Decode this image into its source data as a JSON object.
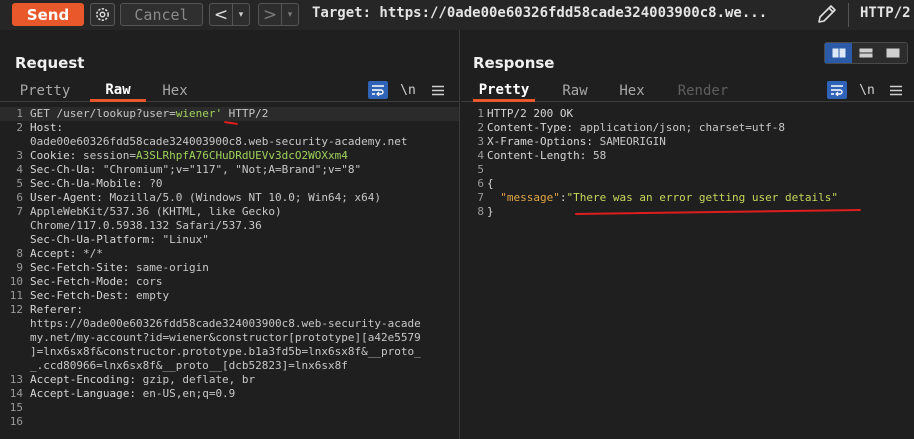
{
  "toolbar": {
    "send_label": "Send",
    "cancel_label": "Cancel",
    "back_glyph": "<",
    "forward_glyph": ">",
    "dropdown_glyph": "▾",
    "target_text": "Target: https://0ade00e60326fdd58cade324003900c8.we...",
    "protocol": "HTTP/2"
  },
  "request": {
    "title": "Request",
    "tabs": [
      {
        "label": "Pretty",
        "active": false
      },
      {
        "label": "Raw",
        "active": true
      },
      {
        "label": "Hex",
        "active": false
      }
    ],
    "newline_toggle": "\\n",
    "gutter": [
      "1",
      "2",
      "",
      "3",
      "4",
      "5",
      "6",
      "7",
      "",
      "",
      "8",
      "9",
      "10",
      "11",
      "12",
      "",
      "",
      "",
      "",
      "13",
      "14",
      "15",
      "16"
    ],
    "lines": [
      {
        "k": "",
        "v": "GET /user/lookup?user=",
        "g": "wiener'",
        "t": " HTTP/2"
      },
      {
        "k": "Host:",
        "v": "",
        "g": "",
        "t": ""
      },
      {
        "k": "",
        "v": "0ade00e60326fdd58cade324003900c8.web-security-academy.net",
        "g": "",
        "t": ""
      },
      {
        "k": "Cookie:",
        "v": " session=",
        "g": "A3SLRhpfA76CHuDRdUEVv3dcO2WOXxm4",
        "t": ""
      },
      {
        "k": "Sec-Ch-Ua:",
        "v": " \"Chromium\";v=\"117\", \"Not;A=Brand\";v=\"8\"",
        "g": "",
        "t": ""
      },
      {
        "k": "Sec-Ch-Ua-Mobile:",
        "v": " ?0",
        "g": "",
        "t": ""
      },
      {
        "k": "User-Agent:",
        "v": " Mozilla/5.0 (Windows NT 10.0; Win64; x64)",
        "g": "",
        "t": ""
      },
      {
        "k": "",
        "v": "AppleWebKit/537.36 (KHTML, like Gecko)",
        "g": "",
        "t": ""
      },
      {
        "k": "",
        "v": "Chrome/117.0.5938.132 Safari/537.36",
        "g": "",
        "t": ""
      },
      {
        "k": "Sec-Ch-Ua-Platform:",
        "v": " \"Linux\"",
        "g": "",
        "t": ""
      },
      {
        "k": "Accept:",
        "v": " */*",
        "g": "",
        "t": ""
      },
      {
        "k": "Sec-Fetch-Site:",
        "v": " same-origin",
        "g": "",
        "t": ""
      },
      {
        "k": "Sec-Fetch-Mode:",
        "v": " cors",
        "g": "",
        "t": ""
      },
      {
        "k": "Sec-Fetch-Dest:",
        "v": " empty",
        "g": "",
        "t": ""
      },
      {
        "k": "Referer:",
        "v": "",
        "g": "",
        "t": ""
      },
      {
        "k": "",
        "v": "https://0ade00e60326fdd58cade324003900c8.web-security-acade",
        "g": "",
        "t": ""
      },
      {
        "k": "",
        "v": "my.net/my-account?id=wiener&constructor[prototype][a42e5579",
        "g": "",
        "t": ""
      },
      {
        "k": "",
        "v": "]=lnx6sx8f&constructor.prototype.b1a3fd5b=lnx6sx8f&__proto_",
        "g": "",
        "t": ""
      },
      {
        "k": "",
        "v": "_.ccd80966=lnx6sx8f&__proto__[dcb52823]=lnx6sx8f",
        "g": "",
        "t": ""
      },
      {
        "k": "Accept-Encoding:",
        "v": " gzip, deflate, br",
        "g": "",
        "t": ""
      },
      {
        "k": "Accept-Language:",
        "v": " en-US,en;q=0.9",
        "g": "",
        "t": ""
      },
      {
        "k": "",
        "v": "",
        "g": "",
        "t": ""
      },
      {
        "k": "",
        "v": "",
        "g": "",
        "t": ""
      }
    ]
  },
  "response": {
    "title": "Response",
    "tabs": [
      {
        "label": "Pretty",
        "active": true,
        "disabled": false
      },
      {
        "label": "Raw",
        "active": false,
        "disabled": false
      },
      {
        "label": "Hex",
        "active": false,
        "disabled": false
      },
      {
        "label": "Render",
        "active": false,
        "disabled": true
      }
    ],
    "newline_toggle": "\\n",
    "gutter": [
      "1",
      "2",
      "3",
      "4",
      "5",
      "6",
      "7",
      "8"
    ],
    "status_line": "HTTP/2 200 OK",
    "headers": [
      {
        "k": "Content-Type:",
        "v": " application/json; charset=utf-8"
      },
      {
        "k": "X-Frame-Options:",
        "v": " SAMEORIGIN"
      },
      {
        "k": "Content-Length:",
        "v": " 58"
      }
    ],
    "json_open": "{",
    "json_key": "\"message\"",
    "json_colon": ":",
    "json_value": "\"There was an error getting user details\"",
    "json_close": "}"
  },
  "colors": {
    "accent": "#e8582a",
    "annotation": "#e01d1d",
    "active_layout": "#2b5aa8"
  }
}
